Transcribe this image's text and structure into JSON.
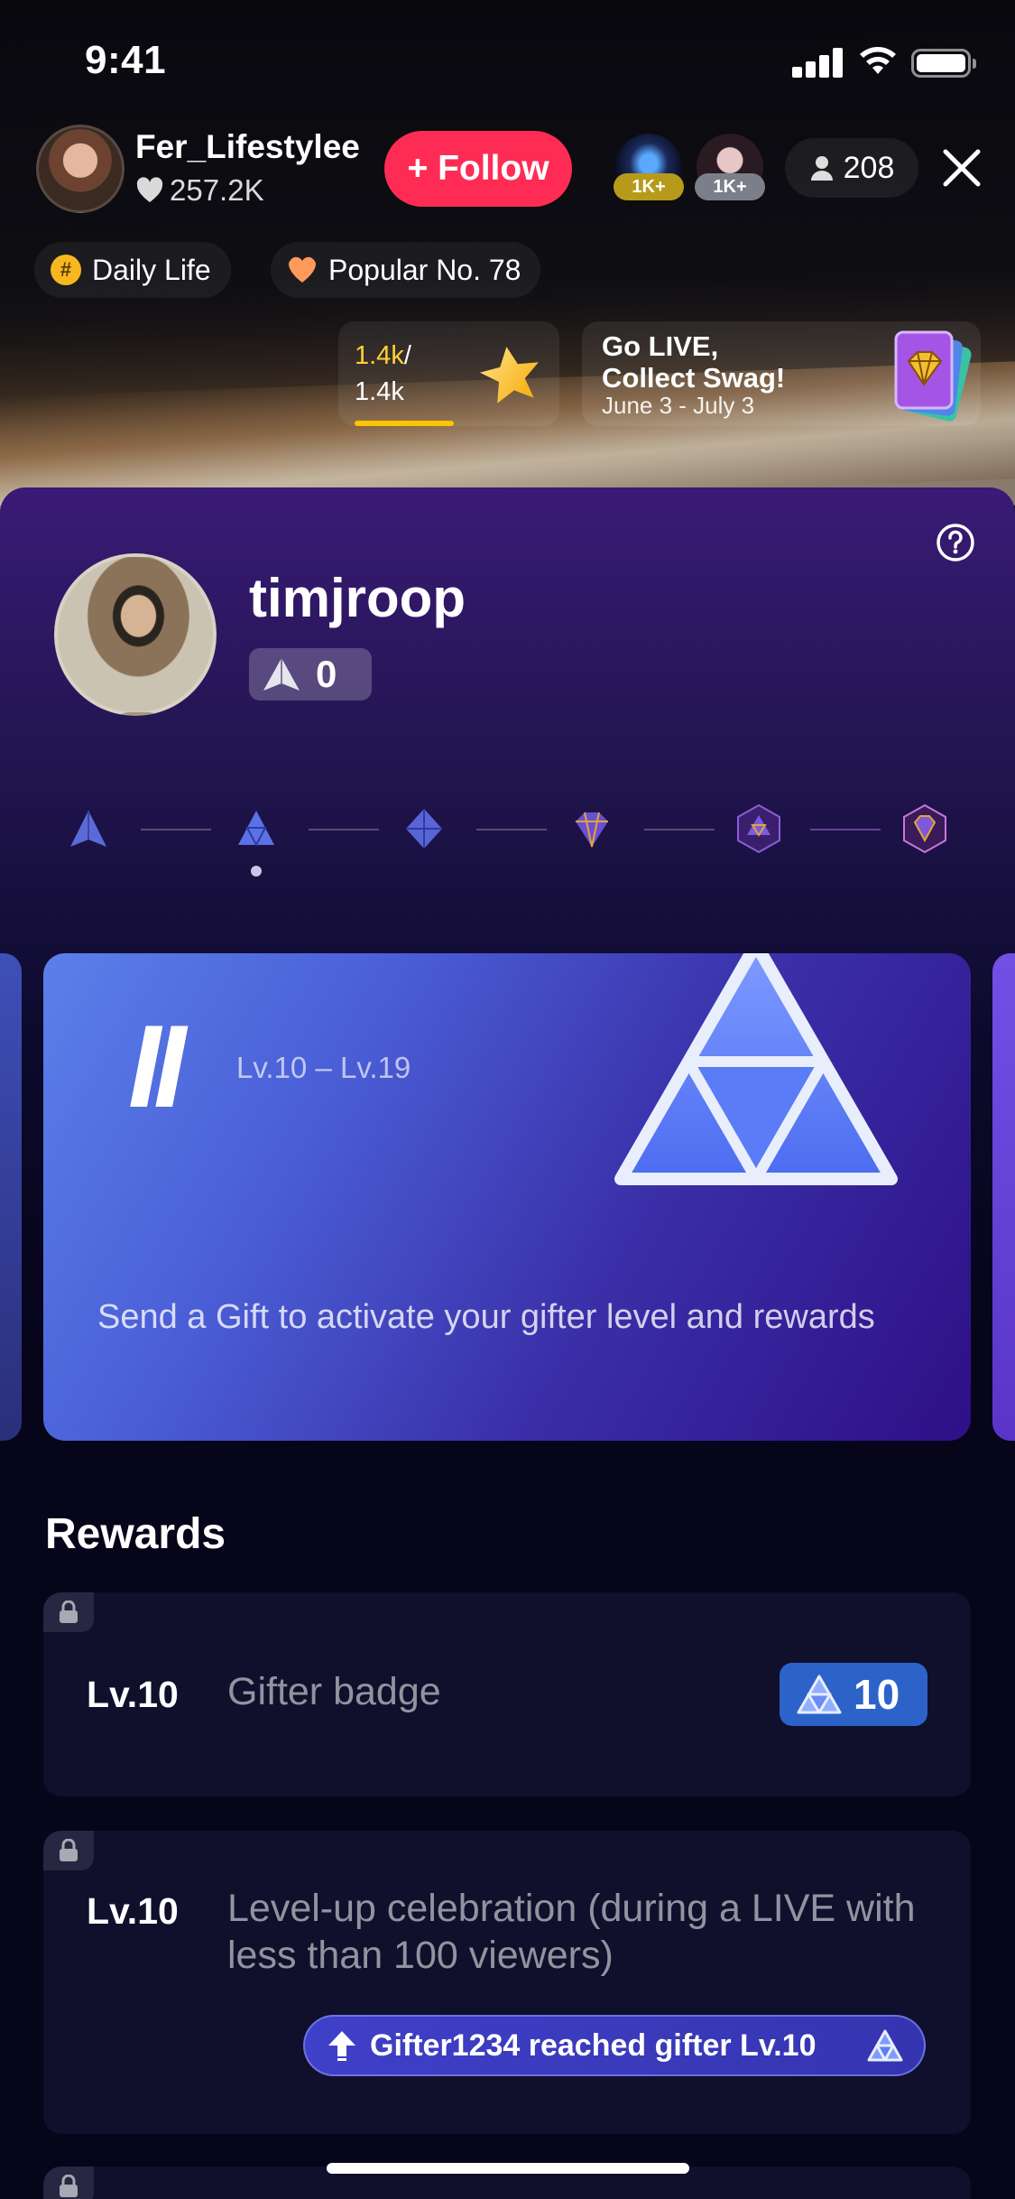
{
  "status_bar": {
    "time": "9:41"
  },
  "host": {
    "name": "Fer_Lifestylee",
    "likes": "257.2K",
    "follow_label": "+ Follow",
    "viewer_badges": [
      "1K+",
      "1K+"
    ],
    "viewer_count": "208"
  },
  "tags": [
    {
      "label": "Daily Life",
      "icon": "hashtag-icon"
    },
    {
      "label": "Popular No. 78",
      "icon": "heart-icon"
    }
  ],
  "star_progress": {
    "current": "1.4k",
    "separator": "/",
    "total": "1.4k",
    "fill": 1.0
  },
  "promo": {
    "title_line1": "Go LIVE,",
    "title_line2": "Collect Swag!",
    "dates": "June 3 - July 3"
  },
  "profile": {
    "username": "timjroop",
    "level": "0"
  },
  "level_track": {
    "tiers": [
      "tier-1-icon",
      "tier-2-icon",
      "tier-3-icon",
      "tier-4-icon",
      "tier-5-icon",
      "tier-6-icon"
    ],
    "selected_index": 1
  },
  "level_card": {
    "roman": "II",
    "range": "Lv.10 – Lv.19",
    "description": "Send a Gift to activate your gifter level and rewards"
  },
  "rewards": {
    "title": "Rewards",
    "items": [
      {
        "level": "Lv.10",
        "description": "Gifter badge",
        "badge_value": "10"
      },
      {
        "level": "Lv.10",
        "description": "Level-up celebration (during a LIVE with less than 100 viewers)",
        "preview": "Gifter1234 reached gifter Lv.10"
      }
    ]
  },
  "colors": {
    "follow": "#fe2c55",
    "accent_gold": "#ffd235",
    "badge_blue": "#2d63c9",
    "panel_bg": "#06051a"
  }
}
